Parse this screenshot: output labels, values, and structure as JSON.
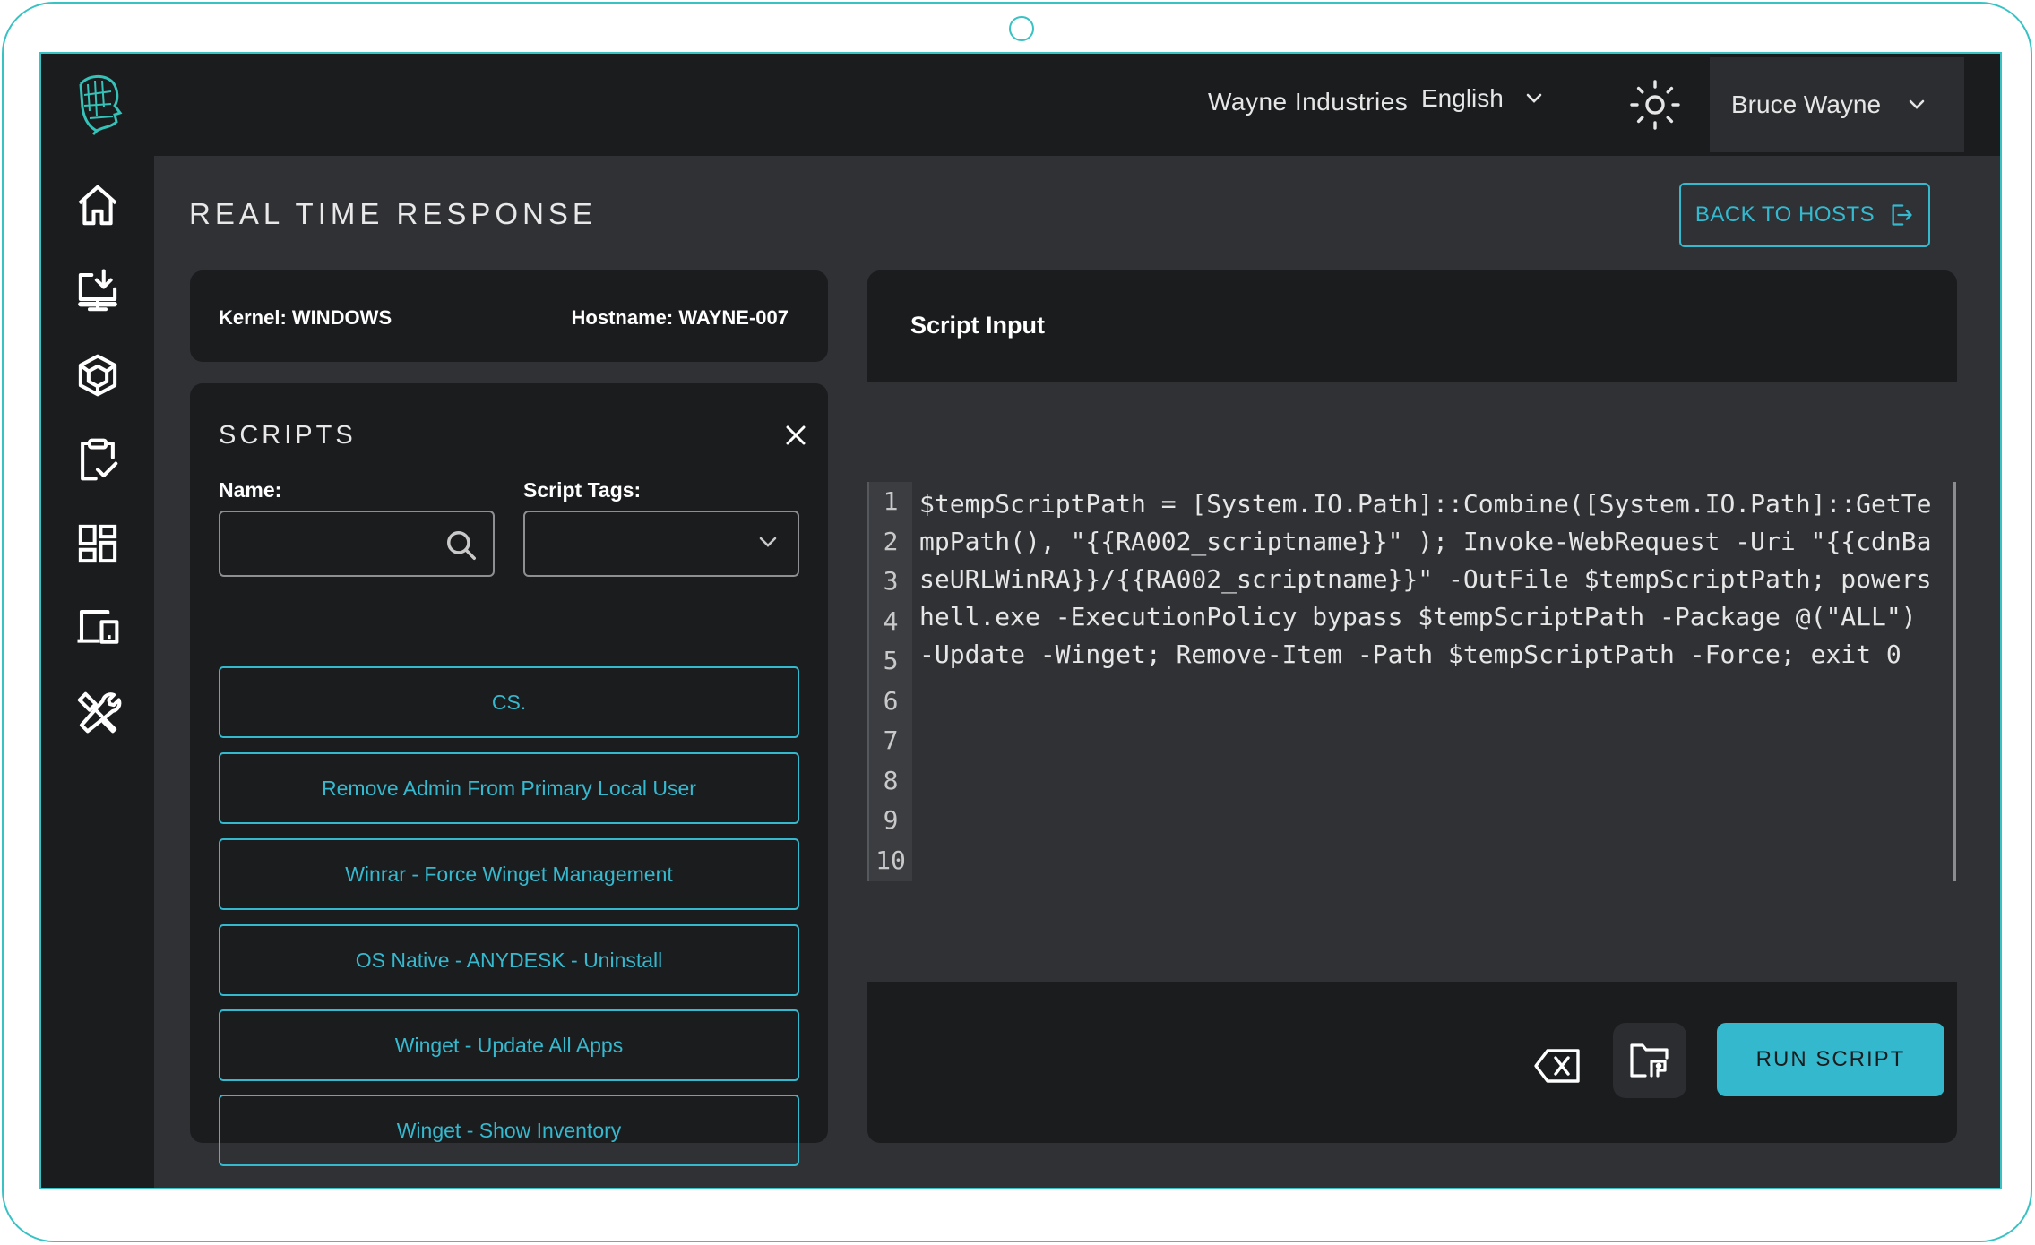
{
  "topbar": {
    "org_name": "Wayne Industries",
    "language": "English",
    "user_name": "Bruce Wayne"
  },
  "sidebar": {
    "items": [
      {
        "icon": "home-icon"
      },
      {
        "icon": "download-monitor-icon"
      },
      {
        "icon": "cube-icon"
      },
      {
        "icon": "clipboard-check-icon"
      },
      {
        "icon": "dashboard-grid-icon"
      },
      {
        "icon": "devices-icon"
      },
      {
        "icon": "tools-icon"
      }
    ]
  },
  "page": {
    "title": "REAL TIME RESPONSE",
    "back_button": "BACK TO HOSTS"
  },
  "host": {
    "kernel": "Kernel: WINDOWS",
    "hostname": "Hostname: WAYNE-007"
  },
  "scripts_panel": {
    "title": "SCRIPTS",
    "name_label": "Name:",
    "name_value": "",
    "tags_label": "Script Tags:",
    "tags_value": "",
    "items": [
      "CS.",
      "Remove Admin From Primary Local User",
      "Winrar - Force Winget Management",
      "OS Native - ANYDESK - Uninstall",
      "Winget - Update All Apps",
      "Winget - Show Inventory"
    ]
  },
  "editor": {
    "title": "Script Input",
    "line_numbers": [
      "1",
      "2",
      "3",
      "4",
      "5",
      "6",
      "7",
      "8",
      "9",
      "10"
    ],
    "code": "$tempScriptPath = [System.IO.Path]::Combine([System.IO.Path]::GetTempPath(), \"{{RA002_scriptname}}\" ); Invoke-WebRequest -Uri \"{{cdnBaseURLWinRA}}/{{RA002_scriptname}}\" -OutFile $tempScriptPath; powershell.exe -ExecutionPolicy bypass $tempScriptPath -Package @(\"ALL\") -Update -Winget; Remove-Item -Path $tempScriptPath -Force; exit 0",
    "run_label": "RUN SCRIPT"
  },
  "colors": {
    "accent": "#35b9cf",
    "panel": "#1b1c1e",
    "background": "#2f3135",
    "frame": "#38c2c4"
  }
}
